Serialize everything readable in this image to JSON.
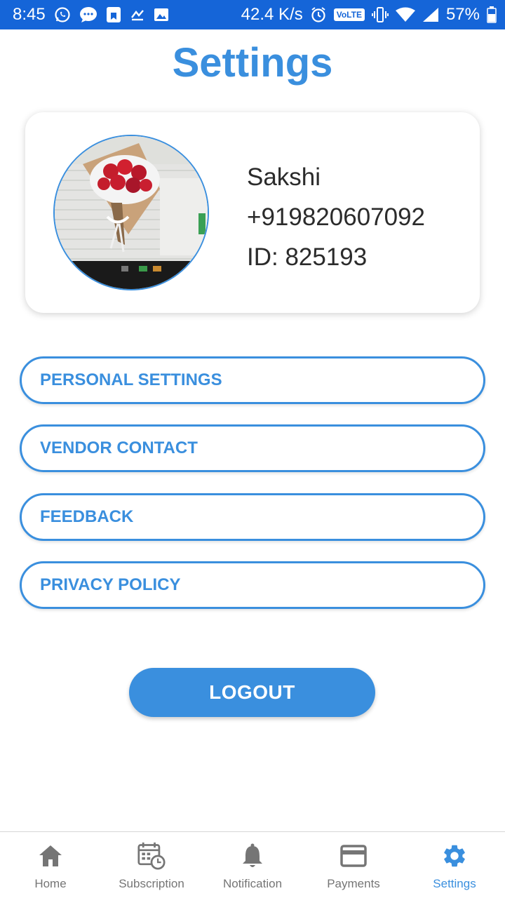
{
  "status_bar": {
    "time": "8:45",
    "net_speed": "42.4 K/s",
    "volte": "VoLTE",
    "battery": "57%"
  },
  "page": {
    "title": "Settings"
  },
  "profile": {
    "name": "Sakshi",
    "phone": "+919820607092",
    "id_text": "ID: 825193"
  },
  "options": [
    {
      "label": "PERSONAL SETTINGS"
    },
    {
      "label": "VENDOR CONTACT"
    },
    {
      "label": "FEEDBACK"
    },
    {
      "label": "PRIVACY POLICY"
    }
  ],
  "logout_label": "LOGOUT",
  "nav": {
    "items": [
      {
        "label": "Home",
        "icon": "home-icon"
      },
      {
        "label": "Subscription",
        "icon": "calendar-clock-icon"
      },
      {
        "label": "Notification",
        "icon": "bell-icon"
      },
      {
        "label": "Payments",
        "icon": "credit-card-icon"
      },
      {
        "label": "Settings",
        "icon": "gear-icon",
        "active": true
      }
    ]
  },
  "colors": {
    "accent": "#3a8fde",
    "status_bar": "#1565d8",
    "inactive_nav": "#757575"
  }
}
